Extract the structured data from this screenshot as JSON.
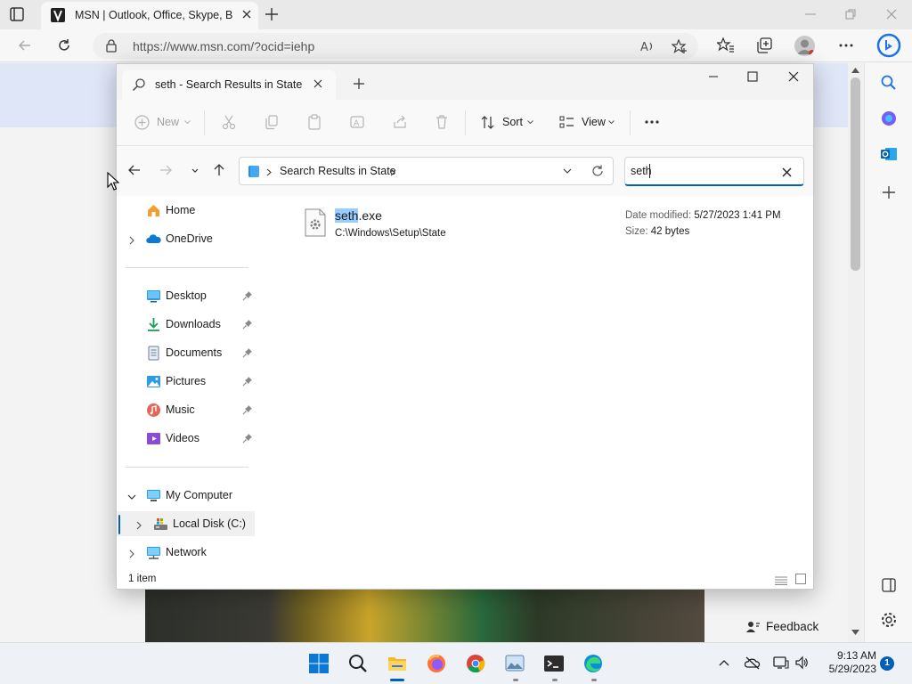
{
  "browser": {
    "tab_title": "MSN | Outlook, Office, Skype, Bing",
    "url": "https://www.msn.com/?ocid=iehp",
    "feedback_label": "Feedback"
  },
  "explorer": {
    "tab_title": "seth - Search Results in State",
    "commands": {
      "new": "New",
      "sort": "Sort",
      "view": "View"
    },
    "address": {
      "location": "Search Results in State"
    },
    "search": {
      "value": "seth"
    },
    "nav": {
      "home": "Home",
      "onedrive": "OneDrive",
      "desktop": "Desktop",
      "downloads": "Downloads",
      "documents": "Documents",
      "pictures": "Pictures",
      "music": "Music",
      "videos": "Videos",
      "my_computer": "My Computer",
      "local_disk": "Local Disk (C:)",
      "network": "Network"
    },
    "results": [
      {
        "name_match": "seth",
        "name_rest": ".exe",
        "path": "C:\\Windows\\Setup\\State",
        "date_label": "Date modified:",
        "date_value": "5/27/2023 1:41 PM",
        "size_label": "Size:",
        "size_value": "42 bytes"
      }
    ],
    "status": "1 item"
  },
  "taskbar": {
    "time": "9:13 AM",
    "date": "5/29/2023",
    "notifications": "1"
  }
}
